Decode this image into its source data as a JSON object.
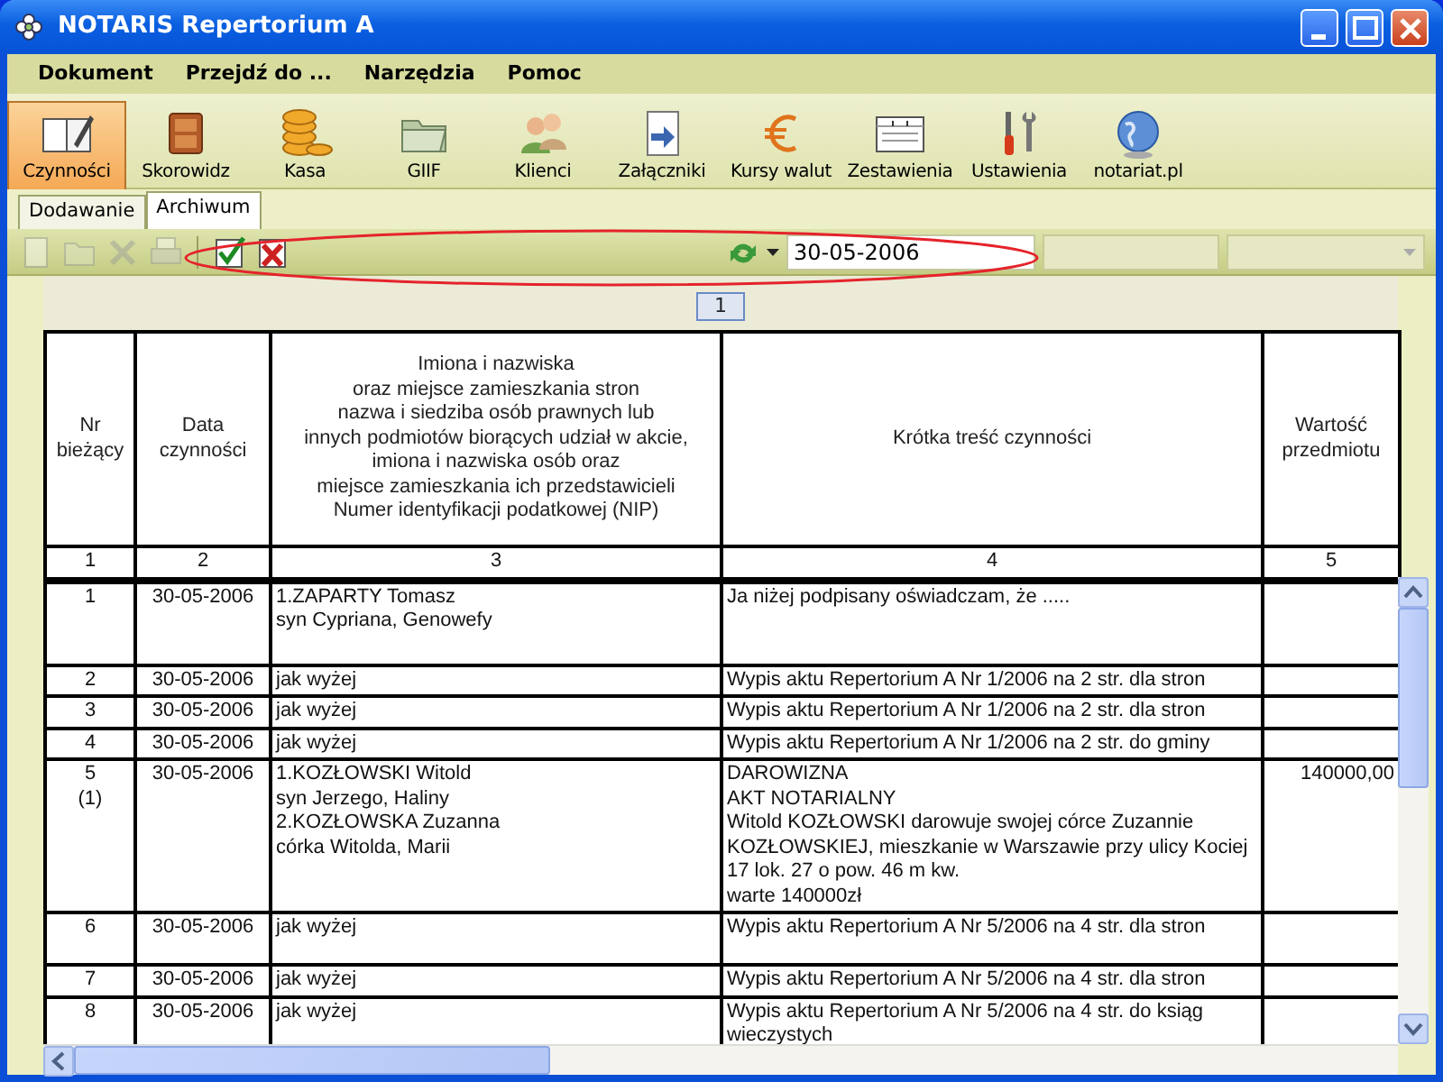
{
  "window": {
    "title": "NOTARIS Repertorium A"
  },
  "menu": [
    "Dokument",
    "Przejdź do ...",
    "Narzędzia",
    "Pomoc"
  ],
  "toolbar": [
    {
      "kind": "book",
      "label": "Czynności",
      "selected": true
    },
    {
      "kind": "cabinet",
      "label": "Skorowidz",
      "selected": false
    },
    {
      "kind": "coins",
      "label": "Kasa",
      "selected": false
    },
    {
      "kind": "folder",
      "label": "GIIF",
      "selected": false
    },
    {
      "kind": "people",
      "label": "Klienci",
      "selected": false
    },
    {
      "kind": "attach",
      "label": "Załączniki",
      "selected": false
    },
    {
      "kind": "euro",
      "label": "Kursy walut",
      "selected": false
    },
    {
      "kind": "report",
      "label": "Zestawienia",
      "selected": false
    },
    {
      "kind": "tools",
      "label": "Ustawienia",
      "selected": false
    },
    {
      "kind": "globe",
      "label": "notariat.pl",
      "selected": false
    }
  ],
  "tabs": [
    {
      "label": "Dodawanie",
      "selected": false
    },
    {
      "label": "Archiwum",
      "selected": true
    }
  ],
  "actions": [
    {
      "kind": "new",
      "disabled": true
    },
    {
      "kind": "open",
      "disabled": true
    },
    {
      "kind": "delete",
      "disabled": true
    },
    {
      "kind": "print",
      "disabled": true
    },
    {
      "kind": "approve",
      "disabled": false
    },
    {
      "kind": "reject",
      "disabled": false
    }
  ],
  "date_field": {
    "value": "30-05-2006"
  },
  "highlight_ellipse": true,
  "page_tab": "1",
  "table": {
    "columns": [
      {
        "title": "Nr\nbieżący",
        "number": "1"
      },
      {
        "title": "Data\nczynności",
        "number": "2"
      },
      {
        "title": "Imiona i nazwiska\noraz miejsce zamieszkania stron\nnazwa i siedziba osób prawnych lub\ninnych podmiotów biorących udział w akcie,\nimiona i nazwiska osób oraz\nmiejsce zamieszkania ich przedstawicieli\nNumer identyfikacji podatkowej (NIP)",
        "number": "3"
      },
      {
        "title": "Krótka treść czynności",
        "number": "4"
      },
      {
        "title": "Wartość\nprzedmiotu",
        "number": "5"
      }
    ],
    "rows": [
      {
        "nr": "1",
        "date": "30-05-2006",
        "parties": "1.ZAPARTY Tomasz\nsyn Cypriana, Genowefy",
        "content": "Ja niżej podpisany oświadczam, że .....",
        "value": ""
      },
      {
        "nr": "2",
        "date": "30-05-2006",
        "parties": "jak wyżej",
        "content": "Wypis aktu Repertorium A Nr 1/2006 na 2 str. dla stron",
        "value": ""
      },
      {
        "nr": "3",
        "date": "30-05-2006",
        "parties": "jak wyżej",
        "content": "Wypis aktu Repertorium A Nr 1/2006 na 2 str. dla stron",
        "value": ""
      },
      {
        "nr": "4",
        "date": "30-05-2006",
        "parties": "jak wyżej",
        "content": "Wypis aktu Repertorium A Nr 1/2006 na 2 str. do gminy",
        "value": ""
      },
      {
        "nr": "5\n(1)",
        "date": "30-05-2006",
        "parties": "1.KOZŁOWSKI Witold\nsyn Jerzego, Haliny\n2.KOZŁOWSKA Zuzanna\ncórka Witolda, Marii",
        "content": "DAROWIZNA\nAKT NOTARIALNY\nWitold KOZŁOWSKI darowuje swojej córce Zuzannie KOZŁOWSKIEJ, mieszkanie w Warszawie przy ulicy Kociej 17 lok. 27 o pow. 46 m kw.\nwarte 140000zł",
        "value": "140000,00"
      },
      {
        "nr": "6",
        "date": "30-05-2006",
        "parties": "jak wyżej",
        "content": "Wypis aktu Repertorium A Nr 5/2006 na 4 str. dla stron",
        "value": ""
      },
      {
        "nr": "7",
        "date": "30-05-2006",
        "parties": "jak wyżej",
        "content": "Wypis aktu Repertorium A Nr 5/2006 na 4 str. dla stron",
        "value": ""
      },
      {
        "nr": "8",
        "date": "30-05-2006",
        "parties": "jak wyżej",
        "content": "Wypis aktu Repertorium A Nr 5/2006 na 4 str. do ksiąg wieczystych",
        "value": ""
      }
    ]
  }
}
